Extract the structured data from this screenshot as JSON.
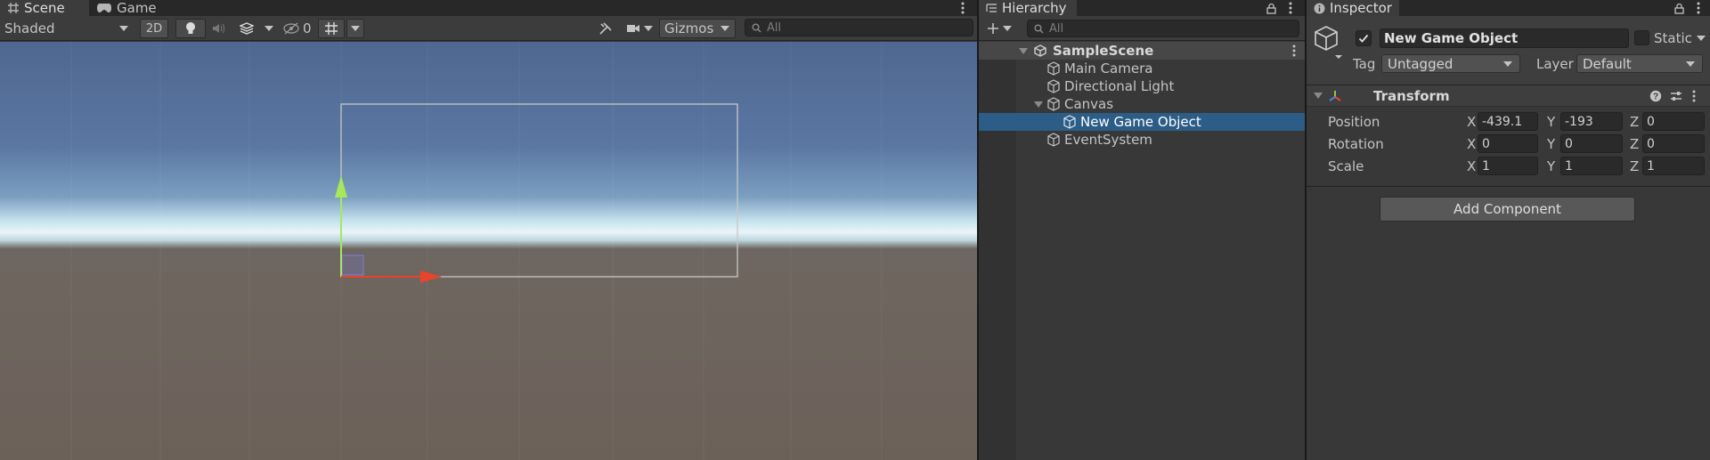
{
  "scene_view": {
    "tabs": [
      {
        "label": "Scene",
        "icon": "scene-grid-icon",
        "active": true
      },
      {
        "label": "Game",
        "icon": "game-controller-icon",
        "active": false
      }
    ],
    "toolbar": {
      "draw_mode": "Shaded",
      "toggle_2d": "2D",
      "hidden_count": "0",
      "gizmos": "Gizmos",
      "search_placeholder": "All"
    },
    "colors": {
      "sky_top": "#506a94",
      "horizon": "#e9f4f8",
      "ground": "#6c6159",
      "x_axis": "#e8442a",
      "y_axis": "#a6e85a",
      "canvas_outline": "#c8c8c8"
    }
  },
  "hierarchy": {
    "title": "Hierarchy",
    "search_placeholder": "All",
    "scene_name": "SampleScene",
    "items": [
      {
        "label": "Main Camera",
        "depth": 1,
        "selected": false
      },
      {
        "label": "Directional Light",
        "depth": 1,
        "selected": false
      },
      {
        "label": "Canvas",
        "depth": 1,
        "expanded": true,
        "selected": false
      },
      {
        "label": "New Game Object",
        "depth": 2,
        "selected": true
      },
      {
        "label": "EventSystem",
        "depth": 1,
        "selected": false
      }
    ],
    "selection_color": "#2c5d87"
  },
  "inspector": {
    "title": "Inspector",
    "object_name": "New Game Object",
    "active": true,
    "static_label": "Static",
    "tag_label": "Tag",
    "tag_value": "Untagged",
    "layer_label": "Layer",
    "layer_value": "Default",
    "transform": {
      "title": "Transform",
      "rows": [
        {
          "label": "Position",
          "x": "-439.1",
          "y": "-193",
          "z": "0"
        },
        {
          "label": "Rotation",
          "x": "0",
          "y": "0",
          "z": "0"
        },
        {
          "label": "Scale",
          "x": "1",
          "y": "1",
          "z": "1"
        }
      ],
      "axis_labels": [
        "X",
        "Y",
        "Z"
      ]
    },
    "add_component": "Add Component"
  }
}
